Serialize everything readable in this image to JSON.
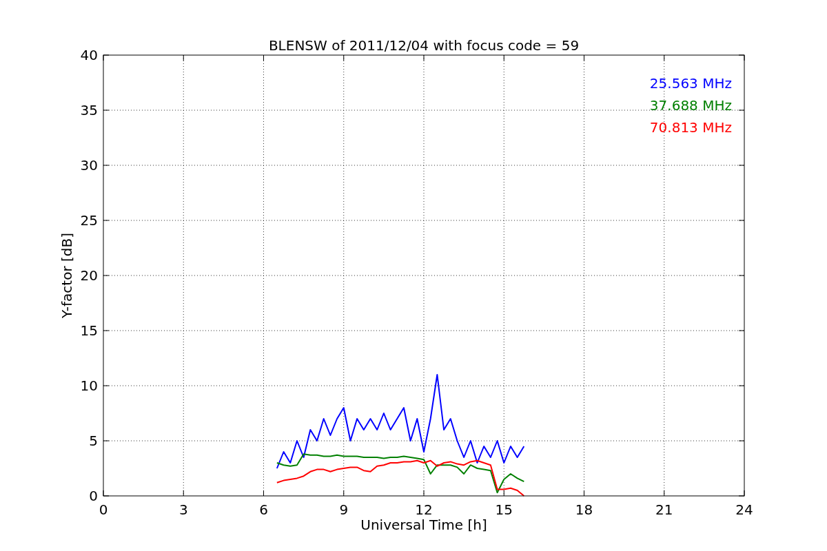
{
  "chart_data": {
    "type": "line",
    "title": "BLENSW of 2011/12/04 with focus code = 59",
    "xlabel": "Universal Time [h]",
    "ylabel": "Y-factor [dB]",
    "x": [
      6.5,
      6.75,
      7,
      7.25,
      7.5,
      7.75,
      8,
      8.25,
      8.5,
      8.75,
      9,
      9.25,
      9.5,
      9.75,
      10,
      10.25,
      10.5,
      10.75,
      11,
      11.25,
      11.5,
      11.75,
      12,
      12.25,
      12.5,
      12.75,
      13,
      13.25,
      13.5,
      13.75,
      14,
      14.25,
      14.5,
      14.75,
      15,
      15.25,
      15.5,
      15.75
    ],
    "series": [
      {
        "name": "25.563 MHz",
        "color": "#0000ff",
        "values": [
          2.5,
          4,
          3,
          5,
          3.5,
          6,
          5,
          7,
          5.5,
          7,
          8,
          5,
          7,
          6,
          7,
          6,
          7.5,
          6,
          7,
          8,
          5,
          7,
          4,
          7,
          11,
          6,
          7,
          5,
          3.5,
          5,
          3,
          4.5,
          3.5,
          5,
          3,
          4.5,
          3.5,
          4.5
        ]
      },
      {
        "name": "37.688 MHz",
        "color": "#008000",
        "values": [
          3,
          2.8,
          2.7,
          2.8,
          3.8,
          3.7,
          3.7,
          3.6,
          3.6,
          3.7,
          3.6,
          3.6,
          3.6,
          3.5,
          3.5,
          3.5,
          3.4,
          3.5,
          3.5,
          3.6,
          3.5,
          3.4,
          3.3,
          2,
          2.8,
          2.8,
          2.8,
          2.6,
          2,
          2.8,
          2.5,
          2.4,
          2.3,
          0.3,
          1.5,
          2,
          1.6,
          1.3
        ]
      },
      {
        "name": "70.813 MHz",
        "color": "#ff0000",
        "values": [
          1.2,
          1.4,
          1.5,
          1.6,
          1.8,
          2.2,
          2.4,
          2.4,
          2.2,
          2.4,
          2.5,
          2.6,
          2.6,
          2.3,
          2.2,
          2.7,
          2.8,
          3,
          3,
          3.1,
          3.1,
          3.2,
          3,
          3.2,
          2.7,
          3,
          3.1,
          2.9,
          2.8,
          3.1,
          3.2,
          3,
          2.8,
          0.6,
          0.6,
          0.7,
          0.5,
          0
        ]
      }
    ],
    "xlim": [
      0,
      24
    ],
    "ylim": [
      0,
      40
    ],
    "grid": true,
    "xticks": [
      0,
      3,
      6,
      9,
      12,
      15,
      18,
      21,
      24
    ],
    "yticks": [
      0,
      5,
      10,
      15,
      20,
      25,
      30,
      35,
      40
    ]
  }
}
